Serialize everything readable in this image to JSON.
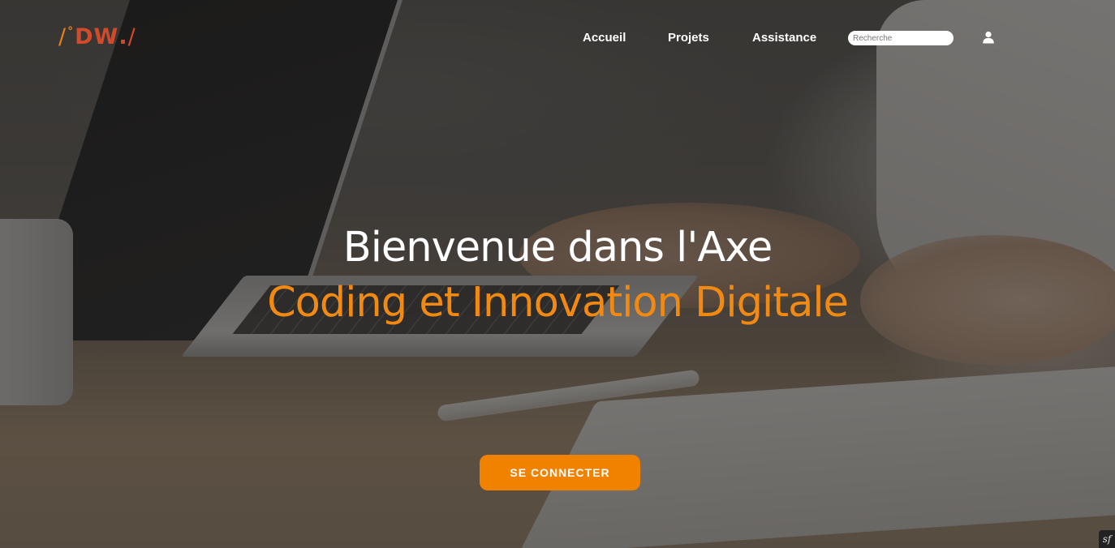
{
  "logo": {
    "slash_start": "/",
    "mark": "°",
    "letters": "DW",
    "dot": ".",
    "slash_end": "/"
  },
  "nav": {
    "items": [
      {
        "label": "Accueil"
      },
      {
        "label": "Projets"
      },
      {
        "label": "Assistance"
      }
    ]
  },
  "search": {
    "placeholder": "Recherche",
    "value": ""
  },
  "user_icon": "user-icon",
  "hero": {
    "title": "Bienvenue dans l'Axe",
    "subtitle": "Coding et Innovation Digitale"
  },
  "cta": {
    "label": "SE CONNECTER"
  },
  "debug_toolbar": {
    "label": "sf"
  },
  "colors": {
    "accent": "#f08200",
    "subtitle": "#f28a11",
    "logo_orange": "#e8801c",
    "logo_red": "#d24a2a"
  }
}
